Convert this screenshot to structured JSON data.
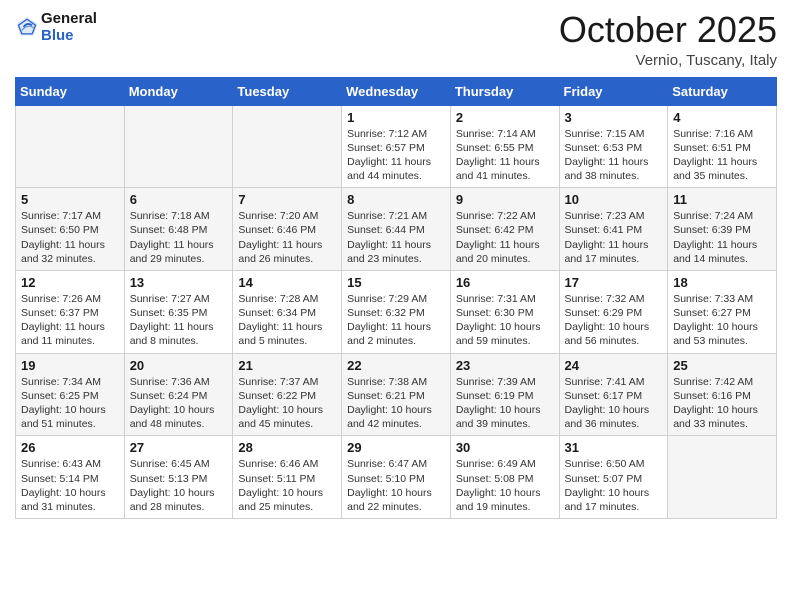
{
  "header": {
    "logo_line1": "General",
    "logo_line2": "Blue",
    "month": "October 2025",
    "location": "Vernio, Tuscany, Italy"
  },
  "weekdays": [
    "Sunday",
    "Monday",
    "Tuesday",
    "Wednesday",
    "Thursday",
    "Friday",
    "Saturday"
  ],
  "weeks": [
    [
      {
        "day": "",
        "info": ""
      },
      {
        "day": "",
        "info": ""
      },
      {
        "day": "",
        "info": ""
      },
      {
        "day": "1",
        "info": "Sunrise: 7:12 AM\nSunset: 6:57 PM\nDaylight: 11 hours and 44 minutes."
      },
      {
        "day": "2",
        "info": "Sunrise: 7:14 AM\nSunset: 6:55 PM\nDaylight: 11 hours and 41 minutes."
      },
      {
        "day": "3",
        "info": "Sunrise: 7:15 AM\nSunset: 6:53 PM\nDaylight: 11 hours and 38 minutes."
      },
      {
        "day": "4",
        "info": "Sunrise: 7:16 AM\nSunset: 6:51 PM\nDaylight: 11 hours and 35 minutes."
      }
    ],
    [
      {
        "day": "5",
        "info": "Sunrise: 7:17 AM\nSunset: 6:50 PM\nDaylight: 11 hours and 32 minutes."
      },
      {
        "day": "6",
        "info": "Sunrise: 7:18 AM\nSunset: 6:48 PM\nDaylight: 11 hours and 29 minutes."
      },
      {
        "day": "7",
        "info": "Sunrise: 7:20 AM\nSunset: 6:46 PM\nDaylight: 11 hours and 26 minutes."
      },
      {
        "day": "8",
        "info": "Sunrise: 7:21 AM\nSunset: 6:44 PM\nDaylight: 11 hours and 23 minutes."
      },
      {
        "day": "9",
        "info": "Sunrise: 7:22 AM\nSunset: 6:42 PM\nDaylight: 11 hours and 20 minutes."
      },
      {
        "day": "10",
        "info": "Sunrise: 7:23 AM\nSunset: 6:41 PM\nDaylight: 11 hours and 17 minutes."
      },
      {
        "day": "11",
        "info": "Sunrise: 7:24 AM\nSunset: 6:39 PM\nDaylight: 11 hours and 14 minutes."
      }
    ],
    [
      {
        "day": "12",
        "info": "Sunrise: 7:26 AM\nSunset: 6:37 PM\nDaylight: 11 hours and 11 minutes."
      },
      {
        "day": "13",
        "info": "Sunrise: 7:27 AM\nSunset: 6:35 PM\nDaylight: 11 hours and 8 minutes."
      },
      {
        "day": "14",
        "info": "Sunrise: 7:28 AM\nSunset: 6:34 PM\nDaylight: 11 hours and 5 minutes."
      },
      {
        "day": "15",
        "info": "Sunrise: 7:29 AM\nSunset: 6:32 PM\nDaylight: 11 hours and 2 minutes."
      },
      {
        "day": "16",
        "info": "Sunrise: 7:31 AM\nSunset: 6:30 PM\nDaylight: 10 hours and 59 minutes."
      },
      {
        "day": "17",
        "info": "Sunrise: 7:32 AM\nSunset: 6:29 PM\nDaylight: 10 hours and 56 minutes."
      },
      {
        "day": "18",
        "info": "Sunrise: 7:33 AM\nSunset: 6:27 PM\nDaylight: 10 hours and 53 minutes."
      }
    ],
    [
      {
        "day": "19",
        "info": "Sunrise: 7:34 AM\nSunset: 6:25 PM\nDaylight: 10 hours and 51 minutes."
      },
      {
        "day": "20",
        "info": "Sunrise: 7:36 AM\nSunset: 6:24 PM\nDaylight: 10 hours and 48 minutes."
      },
      {
        "day": "21",
        "info": "Sunrise: 7:37 AM\nSunset: 6:22 PM\nDaylight: 10 hours and 45 minutes."
      },
      {
        "day": "22",
        "info": "Sunrise: 7:38 AM\nSunset: 6:21 PM\nDaylight: 10 hours and 42 minutes."
      },
      {
        "day": "23",
        "info": "Sunrise: 7:39 AM\nSunset: 6:19 PM\nDaylight: 10 hours and 39 minutes."
      },
      {
        "day": "24",
        "info": "Sunrise: 7:41 AM\nSunset: 6:17 PM\nDaylight: 10 hours and 36 minutes."
      },
      {
        "day": "25",
        "info": "Sunrise: 7:42 AM\nSunset: 6:16 PM\nDaylight: 10 hours and 33 minutes."
      }
    ],
    [
      {
        "day": "26",
        "info": "Sunrise: 6:43 AM\nSunset: 5:14 PM\nDaylight: 10 hours and 31 minutes."
      },
      {
        "day": "27",
        "info": "Sunrise: 6:45 AM\nSunset: 5:13 PM\nDaylight: 10 hours and 28 minutes."
      },
      {
        "day": "28",
        "info": "Sunrise: 6:46 AM\nSunset: 5:11 PM\nDaylight: 10 hours and 25 minutes."
      },
      {
        "day": "29",
        "info": "Sunrise: 6:47 AM\nSunset: 5:10 PM\nDaylight: 10 hours and 22 minutes."
      },
      {
        "day": "30",
        "info": "Sunrise: 6:49 AM\nSunset: 5:08 PM\nDaylight: 10 hours and 19 minutes."
      },
      {
        "day": "31",
        "info": "Sunrise: 6:50 AM\nSunset: 5:07 PM\nDaylight: 10 hours and 17 minutes."
      },
      {
        "day": "",
        "info": ""
      }
    ]
  ]
}
